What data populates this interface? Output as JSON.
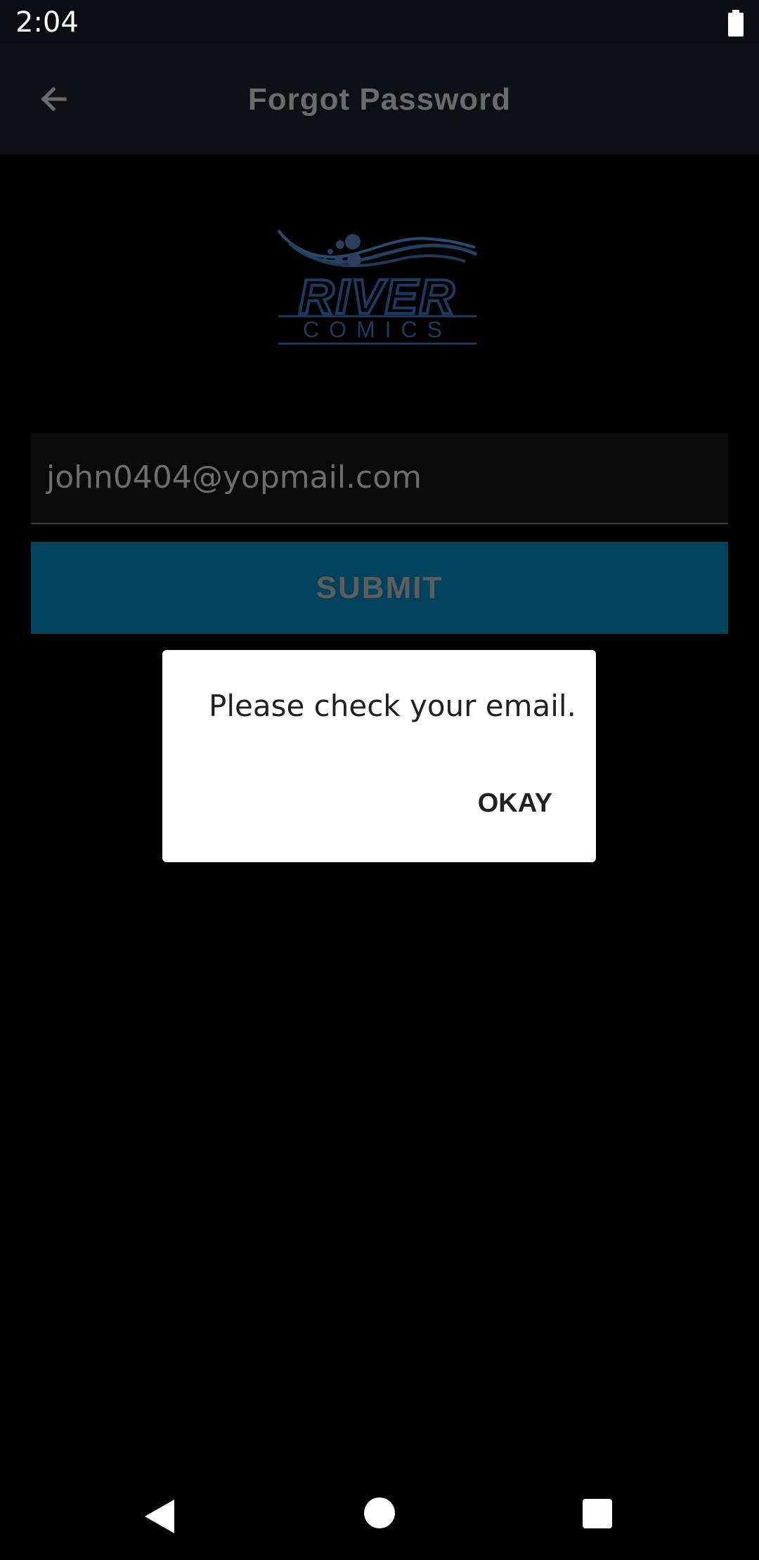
{
  "status_bar": {
    "time": "2:04",
    "battery_icon": "battery-icon"
  },
  "app_bar": {
    "title": "Forgot Password",
    "back_icon": "arrow-left-icon"
  },
  "logo": {
    "line1": "RIVER",
    "line2": "COMICS"
  },
  "form": {
    "email_value": "john0404@yopmail.com",
    "submit_label": "SUBMIT"
  },
  "dialog": {
    "message": "Please check your email.",
    "ok_label": "OKAY"
  },
  "nav_bar": {
    "back_icon": "nav-back-icon",
    "home_icon": "nav-home-icon",
    "recents_icon": "nav-recents-icon"
  },
  "colors": {
    "submit_bg": "#01425d",
    "logo_blue": "#1e3a5f",
    "background": "#000000"
  }
}
